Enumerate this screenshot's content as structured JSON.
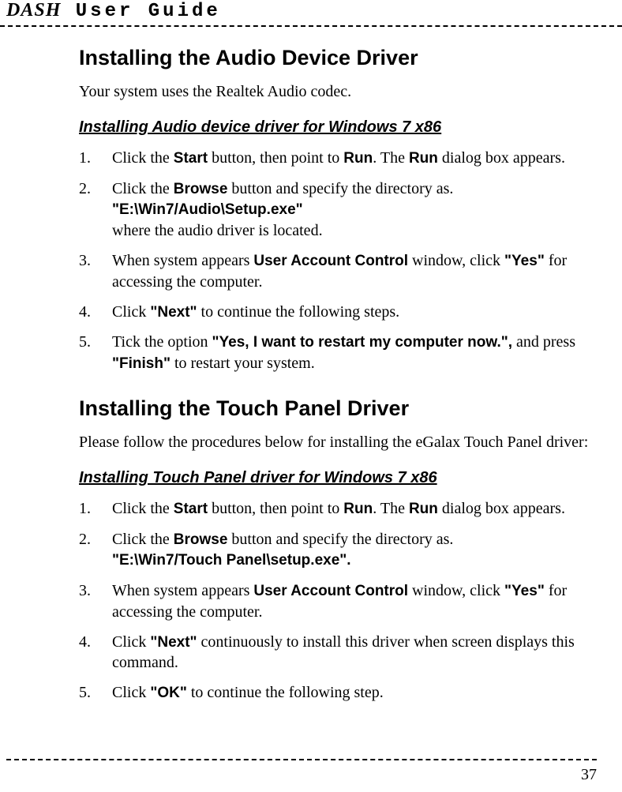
{
  "header": {
    "prefix": "DASH",
    "title": "User Guide"
  },
  "section1": {
    "heading": "Installing the Audio Device Driver",
    "intro": "Your system uses the Realtek Audio codec.",
    "subheading": "Installing Audio device driver for Windows 7 x86",
    "steps": [
      {
        "pre1": "Click the ",
        "b1": "Start",
        "mid1": " button, then point to ",
        "b2": "Run",
        "mid2": ". The ",
        "b3": "Run",
        "post": " dialog box appears."
      },
      {
        "pre1": "Click the ",
        "b1": "Browse",
        "mid1": " button and specify the directory as.",
        "line2b": "\"E:\\Win7/Audio\\Setup.exe\"",
        "line3": "where the audio driver is located."
      },
      {
        "pre1": "When system appears ",
        "b1": "User Account Control",
        "mid1": " window, click ",
        "b2": "\"Yes\"",
        "post": " for accessing the computer."
      },
      {
        "pre1": "Click ",
        "b1": "\"Next\"",
        "post": " to continue the following steps."
      },
      {
        "pre1": "Tick the option ",
        "b1": "\"Yes, I want to restart my computer now.\",",
        "mid1": " and press ",
        "b2": "\"Finish\"",
        "post": " to restart your system."
      }
    ]
  },
  "section2": {
    "heading": "Installing the Touch Panel Driver",
    "intro": "Please follow the procedures below for installing the eGalax Touch Panel driver:",
    "subheading": "Installing Touch Panel driver for Windows 7 x86",
    "steps": [
      {
        "pre1": "Click the ",
        "b1": "Start",
        "mid1": " button, then point to ",
        "b2": "Run",
        "mid2": ". The ",
        "b3": "Run",
        "post": " dialog box appears."
      },
      {
        "pre1": "Click the ",
        "b1": "Browse",
        "mid1": " button and specify the directory as.",
        "line2b": "\"E:\\Win7/Touch Panel\\setup.exe\"."
      },
      {
        "pre1": "When system appears ",
        "b1": "User Account Control",
        "mid1": " window, click ",
        "b2": "\"Yes\"",
        "post": " for accessing the computer."
      },
      {
        "pre1": "Click ",
        "b1": "\"Next\"",
        "post": " continuously to install this driver when screen displays this command."
      },
      {
        "pre1": "Click ",
        "b1": "\"OK\"",
        "post": " to continue the following step."
      }
    ]
  },
  "pageNumber": "37"
}
